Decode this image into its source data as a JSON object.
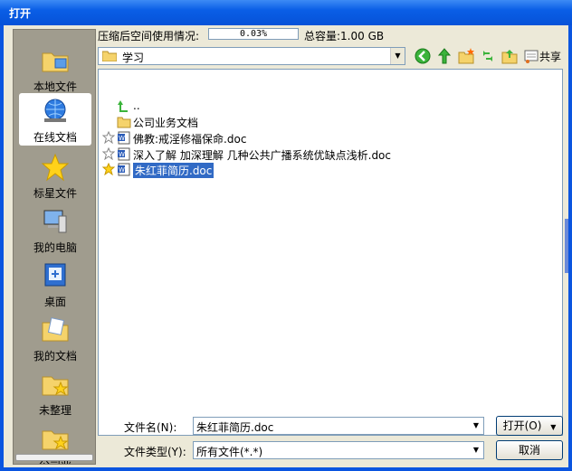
{
  "window": {
    "title": "打开"
  },
  "sidebar": {
    "items": [
      {
        "label": "本地文件",
        "icon": "local-files-icon"
      },
      {
        "label": "在线文档",
        "icon": "online-docs-icon"
      },
      {
        "label": "标星文件",
        "icon": "star-icon"
      },
      {
        "label": "我的电脑",
        "icon": "computer-icon"
      },
      {
        "label": "桌面",
        "icon": "desktop-icon"
      },
      {
        "label": "我的文档",
        "icon": "my-documents-icon"
      },
      {
        "label": "未整理",
        "icon": "unsorted-folder-icon"
      },
      {
        "label": "公司业",
        "icon": "company-folder-icon"
      }
    ],
    "active_index": 1
  },
  "info": {
    "space_label": "压缩后空间使用情况:",
    "usage_percent": "0.03%",
    "total_label": "总容量:1.00 GB"
  },
  "path": {
    "current": "学习"
  },
  "toolbar": {
    "share_label": "共享"
  },
  "files": [
    {
      "name": "..",
      "type": "parent",
      "starred": null
    },
    {
      "name": "公司业务文档",
      "type": "folder",
      "starred": null
    },
    {
      "name": "佛教:戒淫修福保命.doc",
      "type": "doc",
      "starred": false
    },
    {
      "name": "深入了解 加深理解 几种公共广播系统优缺点浅析.doc",
      "type": "doc",
      "starred": false
    },
    {
      "name": "朱红菲简历.doc",
      "type": "doc",
      "starred": true,
      "selected": true
    }
  ],
  "form": {
    "filename_label": "文件名(N):",
    "filename_value": "朱红菲简历.doc",
    "filetype_label": "文件类型(Y):",
    "filetype_value": "所有文件(*.*)",
    "open_button": "打开(O)",
    "cancel_button": "取消"
  },
  "colors": {
    "titlebar": "#0a55e0",
    "selection": "#316ac5",
    "dialog_bg": "#ece9d8"
  }
}
